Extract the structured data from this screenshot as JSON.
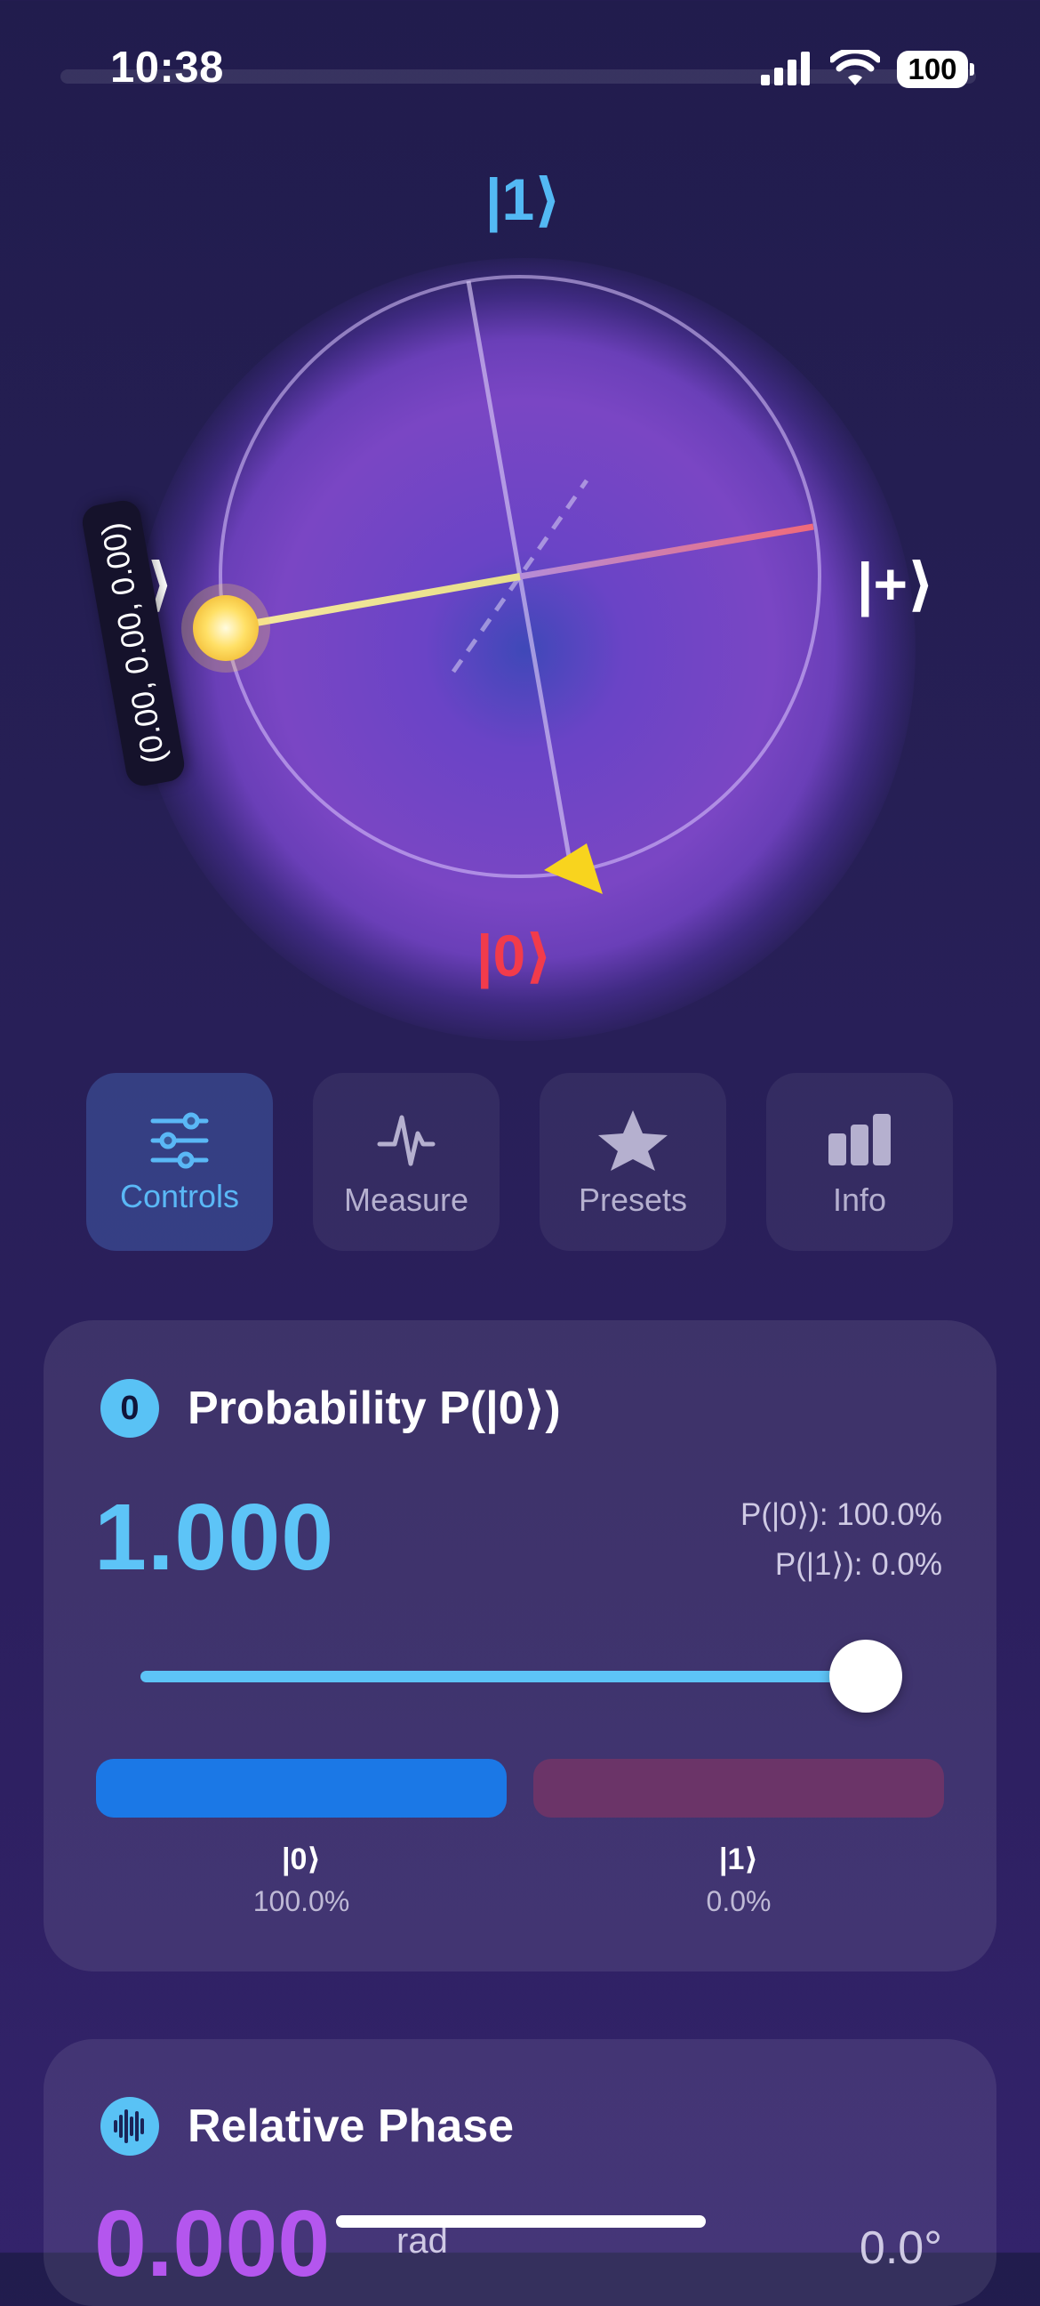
{
  "status_bar": {
    "time": "10:38",
    "battery": "100"
  },
  "bloch": {
    "labels": {
      "one": "|1⟩",
      "zero": "|0⟩",
      "plus": "|+⟩",
      "minus": "|−⟩"
    },
    "tooltip": "(0.00, 0.00, 0.00)"
  },
  "tabs": [
    {
      "label": "Controls",
      "icon": "sliders-icon",
      "active": true
    },
    {
      "label": "Measure",
      "icon": "waveform-icon",
      "active": false
    },
    {
      "label": "Presets",
      "icon": "star-icon",
      "active": false
    },
    {
      "label": "Info",
      "icon": "bar-chart-icon",
      "active": false
    }
  ],
  "probability_card": {
    "badge": "0",
    "title": "Probability P(|0⟩)",
    "value": "1.000",
    "p0_line": "P(|0⟩): 100.0%",
    "p1_line": "P(|1⟩): 0.0%",
    "slider_value": 1.0,
    "states": [
      {
        "label": "|0⟩",
        "percent": "100.0%"
      },
      {
        "label": "|1⟩",
        "percent": "0.0%"
      }
    ]
  },
  "phase_card": {
    "title": "Relative Phase",
    "icon": "waveform-circle-icon",
    "value": "0.000",
    "unit": "rad",
    "right_value": "0.0°"
  },
  "colors": {
    "accent_blue": "#5dc4f7",
    "state_zero_red": "#f23b4b",
    "state_one_blue": "#53b9f4",
    "phase_purple": "#b456ee",
    "state_vector_yellow": "#f4e27a"
  }
}
